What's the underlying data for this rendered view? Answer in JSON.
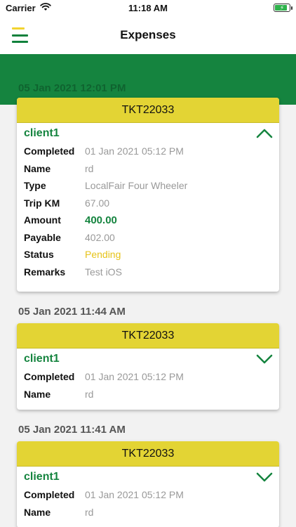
{
  "status_bar": {
    "carrier": "Carrier",
    "time": "11:18 AM"
  },
  "nav": {
    "title": "Expenses"
  },
  "colors": {
    "brand_green": "#15843f",
    "card_header_yellow": "#e3d434",
    "status_pending": "#e6c318"
  },
  "hidden_date": "05 Jan 2021 12:01 PM",
  "expenses": [
    {
      "date": "",
      "ticket": "TKT22033",
      "client": "client1",
      "expanded": true,
      "fields": [
        {
          "label": "Completed",
          "value": "01 Jan 2021 05:12 PM"
        },
        {
          "label": "Name",
          "value": "rd"
        },
        {
          "label": "Type",
          "value": "LocalFair Four Wheeler"
        },
        {
          "label": "Trip KM",
          "value": "67.00"
        },
        {
          "label": "Amount",
          "value": "400.00"
        },
        {
          "label": "Payable",
          "value": "402.00"
        },
        {
          "label": "Status",
          "value": "Pending"
        },
        {
          "label": "Remarks",
          "value": "Test iOS"
        }
      ]
    },
    {
      "date": "05 Jan 2021 11:44 AM",
      "ticket": "TKT22033",
      "client": "client1",
      "expanded": false,
      "fields": [
        {
          "label": "Completed",
          "value": "01 Jan 2021 05:12 PM"
        },
        {
          "label": "Name",
          "value": "rd"
        }
      ]
    },
    {
      "date": "05 Jan 2021 11:41 AM",
      "ticket": "TKT22033",
      "client": "client1",
      "expanded": false,
      "fields": [
        {
          "label": "Completed",
          "value": "01 Jan 2021 05:12 PM"
        },
        {
          "label": "Name",
          "value": "rd"
        }
      ]
    }
  ]
}
